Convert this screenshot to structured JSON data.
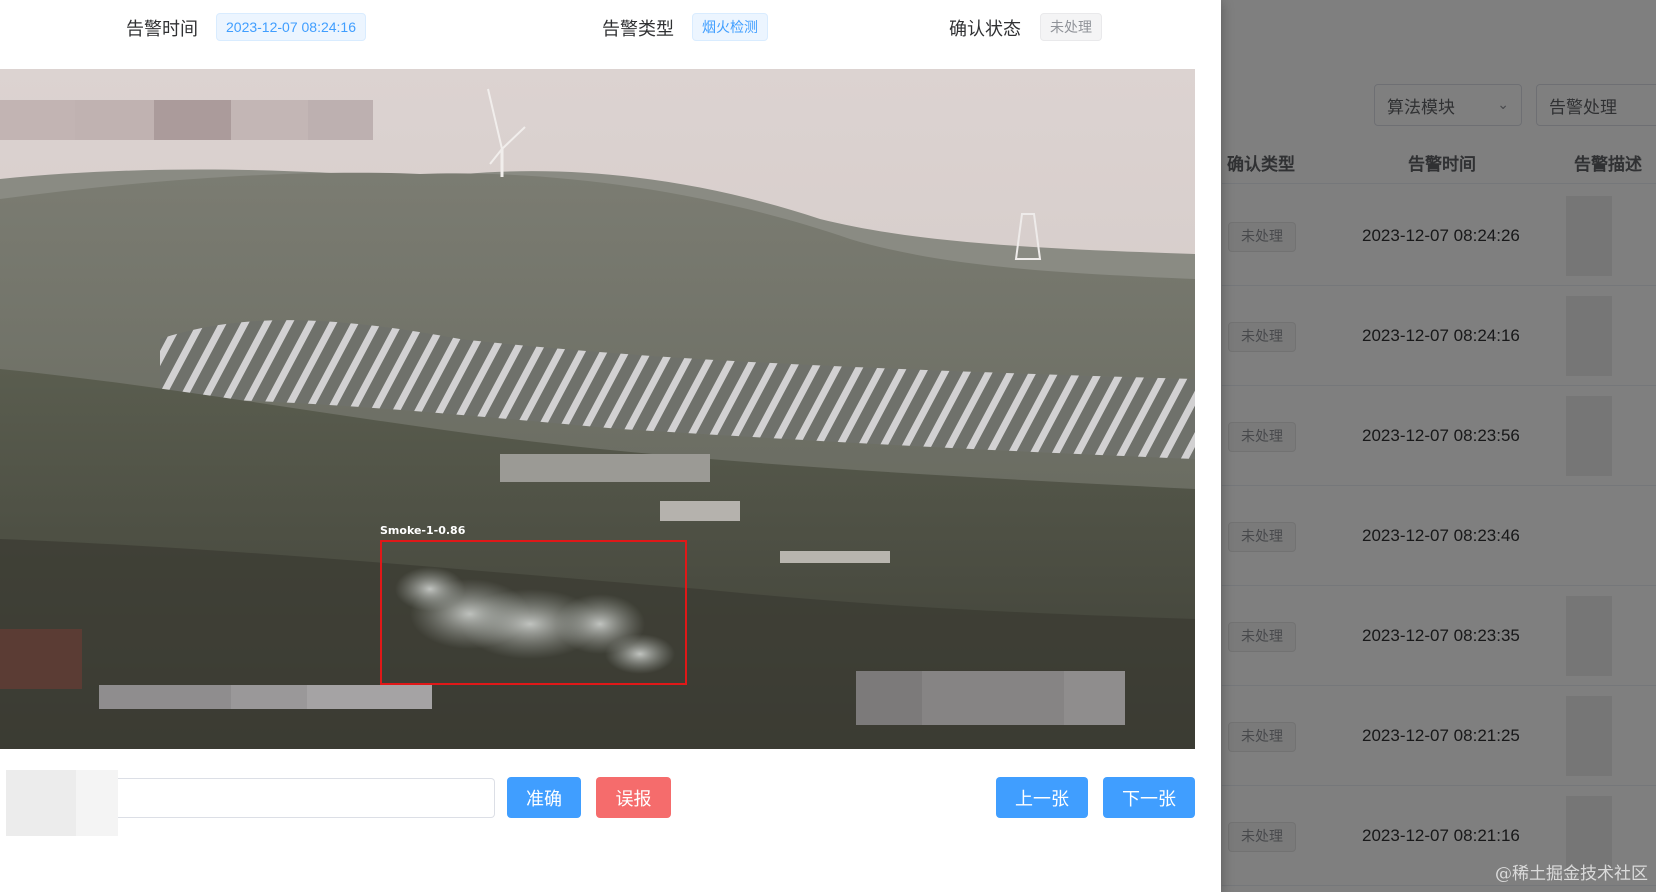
{
  "dialog": {
    "alarm_time_label": "告警时间",
    "alarm_time_value": "2023-12-07 08:24:16",
    "alarm_type_label": "告警类型",
    "alarm_type_value": "烟火检测",
    "confirm_status_label": "确认状态",
    "confirm_status_value": "未处理",
    "detection_label": "Smoke-1-0.86",
    "remark_value": "",
    "accurate_button": "准确",
    "false_alarm_button": "误报",
    "prev_button": "上一张",
    "next_button": "下一张"
  },
  "background": {
    "filter_algorithm": "算法模块",
    "filter_alarm_handling": "告警处理",
    "table_headers": [
      "确认类型",
      "告警时间",
      "告警描述"
    ],
    "rows": [
      {
        "status": "未处理",
        "time": "2023-12-07 08:24:26"
      },
      {
        "status": "未处理",
        "time": "2023-12-07 08:24:16"
      },
      {
        "status": "未处理",
        "time": "2023-12-07 08:23:56"
      },
      {
        "status": "未处理",
        "time": "2023-12-07 08:23:46"
      },
      {
        "status": "未处理",
        "time": "2023-12-07 08:23:35"
      },
      {
        "status": "未处理",
        "time": "2023-12-07 08:21:25"
      },
      {
        "status": "未处理",
        "time": "2023-12-07 08:21:16"
      }
    ],
    "watermark": "@稀土掘金技术社区"
  },
  "colors": {
    "primary": "#409eff",
    "danger": "#f56c6c",
    "detection_box": "#e01818",
    "tag_blue_bg": "#ecf5ff",
    "tag_gray_bg": "#f4f4f5"
  },
  "icons": {
    "filter_dropdown": "chevron-down-icon"
  }
}
